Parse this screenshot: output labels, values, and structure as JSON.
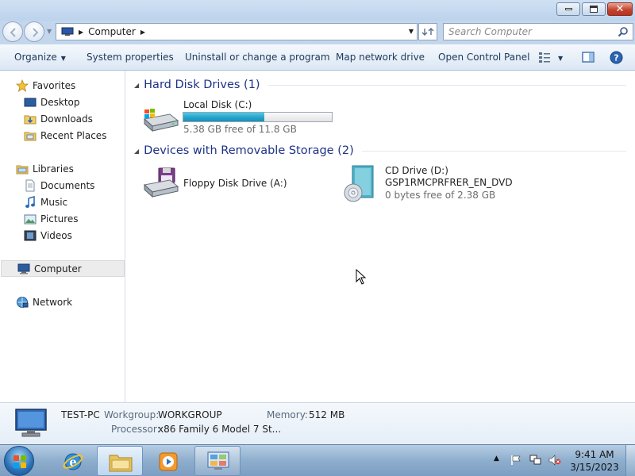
{
  "window": {
    "minimize_icon": "minimize-icon",
    "maximize_icon": "restore-icon",
    "close_icon": "close-icon"
  },
  "address": {
    "crumb": "Computer",
    "search_placeholder": "Search Computer"
  },
  "commandbar": {
    "organize": "Organize",
    "system_properties": "System properties",
    "uninstall": "Uninstall or change a program",
    "map_network": "Map network drive",
    "open_control_panel": "Open Control Panel"
  },
  "sidebar": {
    "favorites": "Favorites",
    "favorites_items": [
      "Desktop",
      "Downloads",
      "Recent Places"
    ],
    "libraries": "Libraries",
    "libraries_items": [
      "Documents",
      "Music",
      "Pictures",
      "Videos"
    ],
    "computer": "Computer",
    "network": "Network"
  },
  "content": {
    "hard_disk_group": "Hard Disk Drives (1)",
    "local_disk": {
      "name": "Local Disk (C:)",
      "free_text": "5.38 GB free of 11.8 GB",
      "used_fraction": 0.544
    },
    "removable_group": "Devices with Removable Storage (2)",
    "floppy": {
      "name": "Floppy Disk Drive (A:)"
    },
    "cd": {
      "name": "CD Drive (D:)",
      "label": "GSP1RMCPRFRER_EN_DVD",
      "free_text": "0 bytes free of 2.38 GB"
    }
  },
  "details": {
    "pc_name": "TEST-PC",
    "workgroup_label": "Workgroup:",
    "workgroup_value": "WORKGROUP",
    "memory_label": "Memory:",
    "memory_value": "512 MB",
    "processor_label": "Processor:",
    "processor_value": "x86 Family 6 Model 7 St..."
  },
  "taskbar": {
    "time": "9:41 AM",
    "date": "3/15/2023"
  },
  "colors": {
    "group_header": "#1e3287",
    "capacity_fill": "#26a3cb",
    "selected_nav": "#ececec"
  }
}
